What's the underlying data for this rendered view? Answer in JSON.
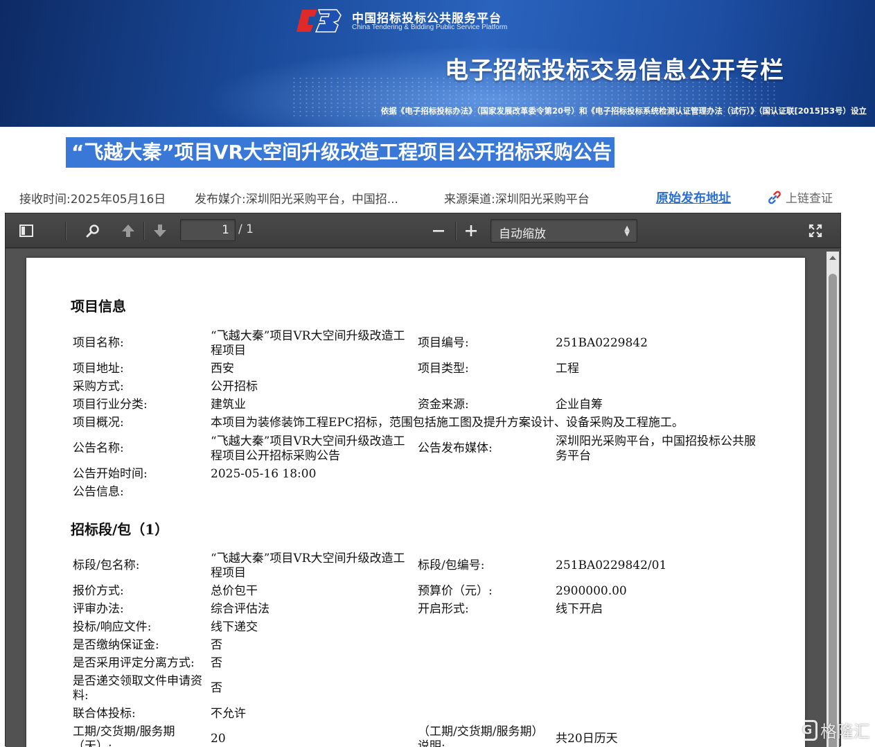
{
  "banner": {
    "platform_cn": "中国招标投标公共服务平台",
    "platform_en": "China Tendering & Bidding Public Service Platform",
    "title": "电子招标投标交易信息公开专栏",
    "basis": "依据《电子招标投标办法》（国家发展改革委令第20号）和《电子招标投标系统检测认证管理办法（试行）》（国认证联[2015]53号）设立"
  },
  "notice": {
    "title": "“飞越大秦”项目VR大空间升级改造工程项目公开招标采购公告"
  },
  "meta": {
    "received": "接收时间:2025年05月16日",
    "media": "发布媒介:深圳阳光采购平台，中国招...",
    "source": "来源渠道:深圳阳光采购平台",
    "original_link": "原始发布地址",
    "chain_verify": "上链查证"
  },
  "viewer": {
    "page_current": "1",
    "page_total": "/ 1",
    "zoom": "自动缩放"
  },
  "doc": {
    "section1": "项目信息",
    "section2": "招标段/包（1）",
    "project": {
      "name_label": "项目名称:",
      "name": "“飞越大秦”项目VR大空间升级改造工程项目",
      "code_label": "项目编号:",
      "code": "251BA0229842",
      "location_label": "项目地址:",
      "location": "西安",
      "type_label": "项目类型:",
      "type": "工程",
      "method_label": "采购方式:",
      "method": "公开招标",
      "industry_label": "项目行业分类:",
      "industry": "建筑业",
      "fund_label": "资金来源:",
      "fund": "企业自筹",
      "overview_label": "项目概况:",
      "overview": "本项目为装修装饰工程EPC招标，范围包括施工图及提升方案设计、设备采购及工程施工。",
      "notice_name_label": "公告名称:",
      "notice_name": "“飞越大秦”项目VR大空间升级改造工程项目公开招标采购公告",
      "notice_media_label": "公告发布媒体:",
      "notice_media": "深圳阳光采购平台，中国招投标公共服务平台",
      "start_label": "公告开始时间:",
      "start": "2025-05-16 18:00",
      "info_label": "公告信息:"
    },
    "lot": {
      "name_label": "标段/包名称:",
      "name": "“飞越大秦”项目VR大空间升级改造工程项目",
      "code_label": "标段/包编号:",
      "code": "251BA0229842/01",
      "quote_label": "报价方式:",
      "quote": "总价包干",
      "budget_label": "预算价（元）:",
      "budget": "2900000.00",
      "review_label": "评审办法:",
      "review": "综合评估法",
      "open_label": "开启形式:",
      "open": "线下开启",
      "bid_doc_label": "投标/响应文件:",
      "bid_doc": "线下递交",
      "deposit_label": "是否缴纳保证金:",
      "deposit": "否",
      "separate_label": "是否采用评定分离方式:",
      "separate": "否",
      "apply_label": "是否递交领取文件申请资料:",
      "apply": "否",
      "consortium_label": "联合体投标:",
      "consortium": "不允许",
      "period_label": "工期/交货期/服务期（天）:",
      "period": "20",
      "period_desc_label": "（工期/交货期/服务期）说明:",
      "period_desc": "共20日历天"
    }
  },
  "watermark": {
    "text": "格隆汇",
    "mark": "G"
  }
}
